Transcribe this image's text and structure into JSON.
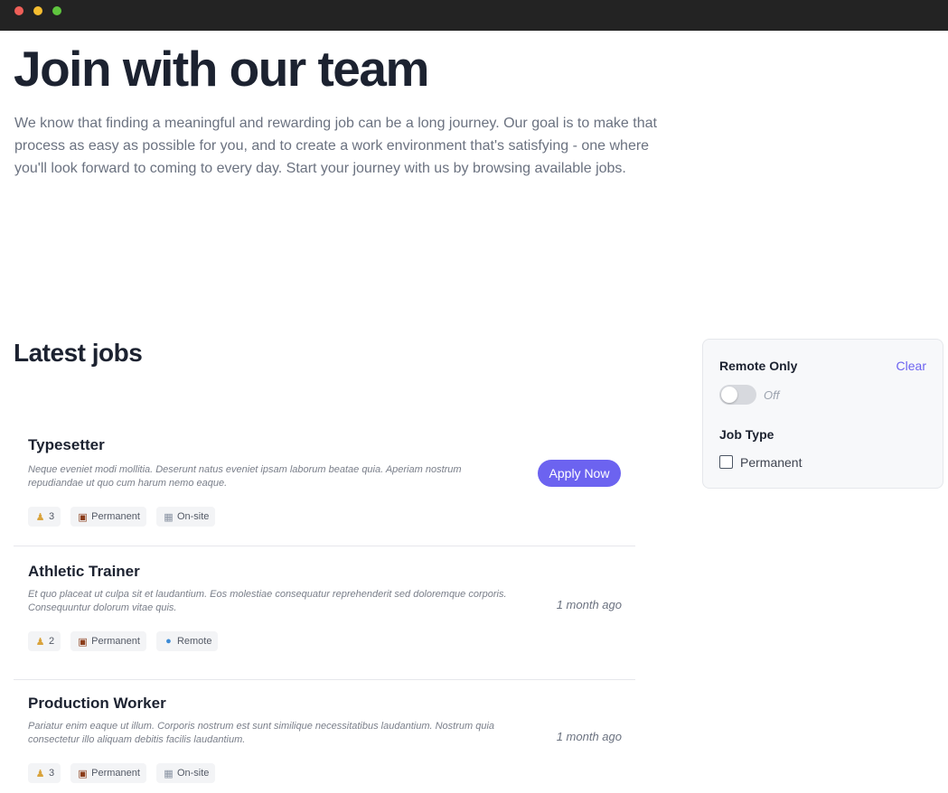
{
  "window": {
    "controls": [
      "close",
      "minimize",
      "maximize"
    ]
  },
  "hero": {
    "title": "Join with our team",
    "description": "We know that finding a meaningful and rewarding job can be a long journey. Our goal is to make that process as easy as possible for you, and to create a work environment that's satisfying - one where you'll look forward to coming to every day. Start your journey with us by browsing available jobs."
  },
  "jobs_section": {
    "title": "Latest jobs",
    "jobs": [
      {
        "title": "Typesetter",
        "description": "Neque eveniet modi mollitia. Deserunt natus eveniet ipsam laborum beatae quia. Aperiam nostrum repudiandae ut quo cum harum nemo eaque.",
        "openings": "3",
        "type": "Permanent",
        "location": "On-site",
        "location_icon": "building-icon",
        "action": "Apply Now",
        "posted": ""
      },
      {
        "title": "Athletic Trainer",
        "description": "Et quo placeat ut culpa sit et laudantium. Eos molestiae consequatur reprehenderit sed doloremque corporis. Consequuntur dolorum vitae quis.",
        "openings": "2",
        "type": "Permanent",
        "location": "Remote",
        "location_icon": "globe-icon",
        "action": "",
        "posted": "1 month ago"
      },
      {
        "title": "Production Worker",
        "description": "Pariatur enim eaque ut illum. Corporis nostrum est sunt similique necessitatibus laudantium. Nostrum quia consectetur illo aliquam debitis facilis laudantium.",
        "openings": "3",
        "type": "Permanent",
        "location": "On-site",
        "location_icon": "building-icon",
        "action": "",
        "posted": "1 month ago"
      }
    ]
  },
  "filters": {
    "remote_label": "Remote Only",
    "clear_label": "Clear",
    "toggle_state": "Off",
    "job_type_label": "Job Type",
    "job_type_options": [
      {
        "label": "Permanent",
        "checked": false
      }
    ]
  },
  "colors": {
    "accent": "#6c63f0",
    "title": "#1c2230",
    "muted": "#6b7280"
  }
}
